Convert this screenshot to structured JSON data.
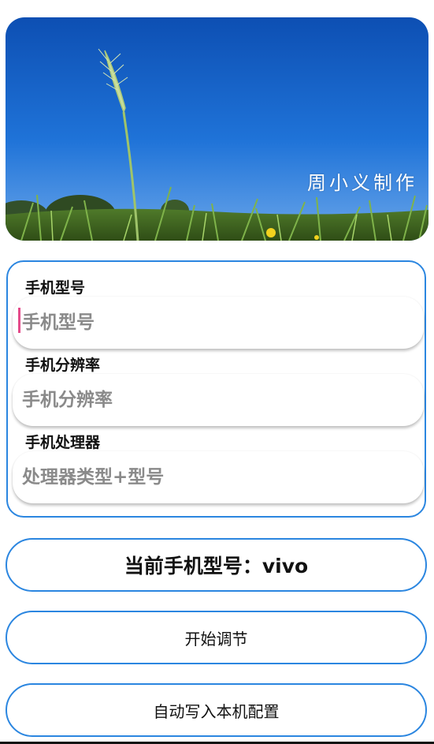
{
  "banner": {
    "caption": "周小义制作"
  },
  "form": {
    "fields": [
      {
        "label": "手机型号",
        "placeholder": "手机型号"
      },
      {
        "label": "手机分辨率",
        "placeholder": "手机分辨率"
      },
      {
        "label": "手机处理器",
        "placeholder": "处理器类型+型号"
      }
    ]
  },
  "model_display": "当前手机型号：vivo",
  "buttons": {
    "start": "开始调节",
    "write": "自动写入本机配置"
  },
  "colors": {
    "accent": "#2b86e0",
    "caret": "#e44b8a"
  }
}
